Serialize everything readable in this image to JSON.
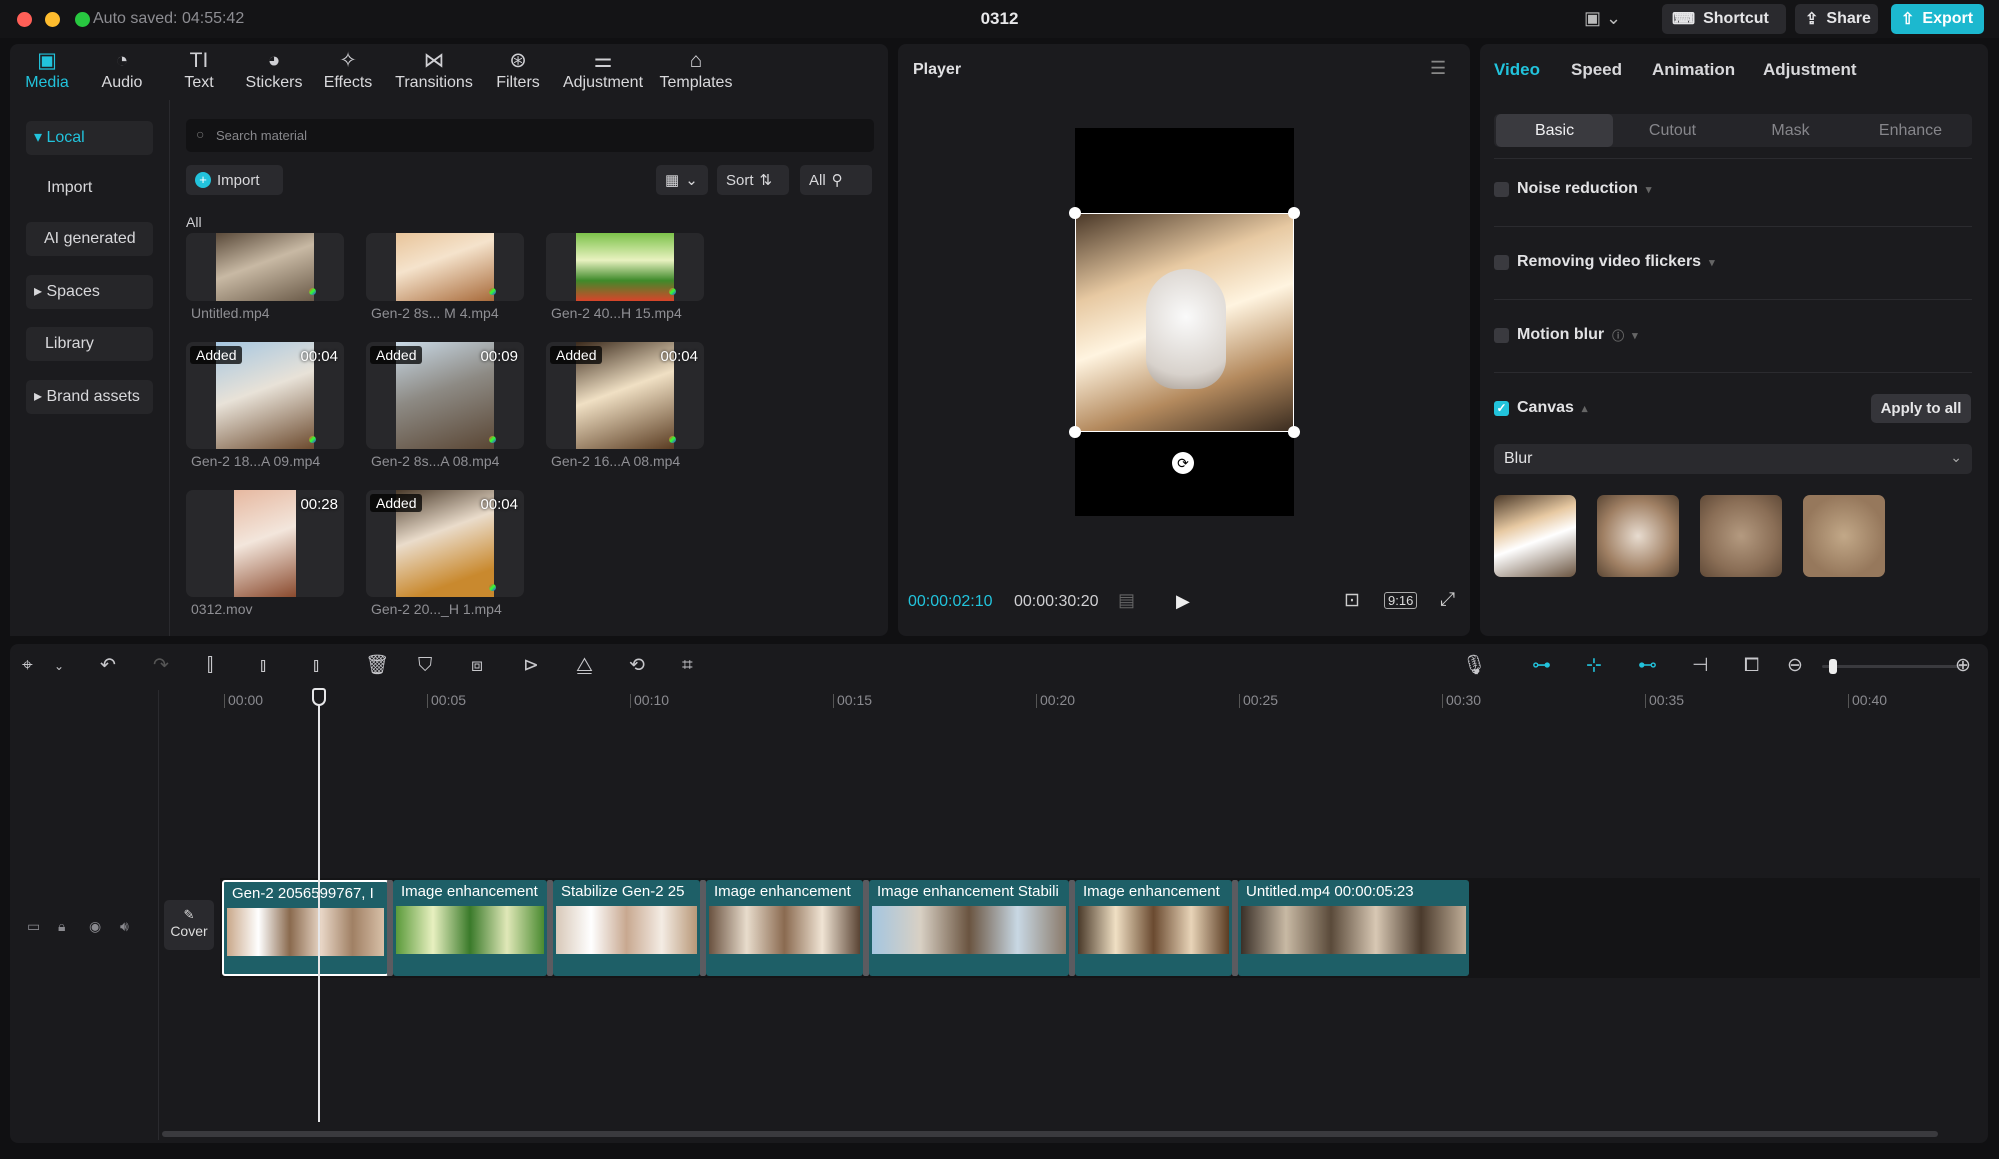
{
  "titlebar": {
    "autosaved": "Auto saved: 04:55:42",
    "project_title": "0312",
    "shortcut_label": "Shortcut",
    "share_label": "Share",
    "export_label": "Export"
  },
  "toolbar": [
    {
      "label": "Media",
      "icon": "media-icon",
      "active": true
    },
    {
      "label": "Audio",
      "icon": "audio-icon"
    },
    {
      "label": "Text",
      "icon": "text-icon"
    },
    {
      "label": "Stickers",
      "icon": "stickers-icon"
    },
    {
      "label": "Effects",
      "icon": "effects-icon"
    },
    {
      "label": "Transitions",
      "icon": "transitions-icon"
    },
    {
      "label": "Filters",
      "icon": "filters-icon"
    },
    {
      "label": "Adjustment",
      "icon": "adjustment-icon"
    },
    {
      "label": "Templates",
      "icon": "templates-icon"
    }
  ],
  "sidebar": {
    "items": [
      {
        "label": "Local",
        "active": true
      },
      {
        "label": "Import"
      },
      {
        "label": "AI generated"
      },
      {
        "label": "Spaces"
      },
      {
        "label": "Library"
      },
      {
        "label": "Brand assets"
      }
    ]
  },
  "media": {
    "search_placeholder": "Search material",
    "import_label": "Import",
    "sort_label": "Sort",
    "filter_all": "All",
    "section_label": "All",
    "items": [
      {
        "name": "Untitled.mp4",
        "badge": "",
        "duration": ""
      },
      {
        "name": "Gen-2 8s... M 4.mp4",
        "badge": "",
        "duration": ""
      },
      {
        "name": "Gen-2 40...H 15.mp4",
        "badge": "",
        "duration": ""
      },
      {
        "name": "Gen-2 18...A 09.mp4",
        "badge": "Added",
        "duration": "00:04"
      },
      {
        "name": "Gen-2 8s...A 08.mp4",
        "badge": "Added",
        "duration": "00:09"
      },
      {
        "name": "Gen-2 16...A 08.mp4",
        "badge": "Added",
        "duration": "00:04"
      },
      {
        "name": "0312.mov",
        "badge": "",
        "duration": "00:28"
      },
      {
        "name": "Gen-2 20..._H 1.mp4",
        "badge": "Added",
        "duration": "00:04"
      }
    ]
  },
  "player": {
    "title": "Player",
    "current_time": "00:00:02:10",
    "total_time": "00:00:30:20",
    "ratio": "9:16"
  },
  "inspector": {
    "tabs": [
      "Video",
      "Speed",
      "Animation",
      "Adjustment"
    ],
    "active_tab": "Video",
    "subtabs": [
      "Basic",
      "Cutout",
      "Mask",
      "Enhance"
    ],
    "active_subtab": "Basic",
    "options": [
      {
        "label": "Noise reduction",
        "checked": false
      },
      {
        "label": "Removing video flickers",
        "checked": false
      },
      {
        "label": "Motion blur",
        "checked": false
      },
      {
        "label": "Canvas",
        "checked": true
      }
    ],
    "apply_to_all": "Apply to all",
    "canvas_mode": "Blur"
  },
  "timeline": {
    "ruler": [
      "00:00",
      "00:05",
      "00:10",
      "00:15",
      "00:20",
      "00:25",
      "00:30",
      "00:35",
      "00:40"
    ],
    "cover_label": "Cover",
    "clips": [
      {
        "label": "Gen-2 2056599767, I"
      },
      {
        "label": "Image enhancement"
      },
      {
        "label": "Stabilize  Gen-2 25"
      },
      {
        "label": "Image enhancement"
      },
      {
        "label": "Image enhancement  Stabili"
      },
      {
        "label": "Image enhancement"
      },
      {
        "label": "Untitled.mp4    00:00:05:23"
      }
    ]
  },
  "colors": {
    "accent": "#22c3dc",
    "export": "#1cb8cf",
    "clip": "#1e5f67",
    "panel": "#1b1b1e"
  }
}
